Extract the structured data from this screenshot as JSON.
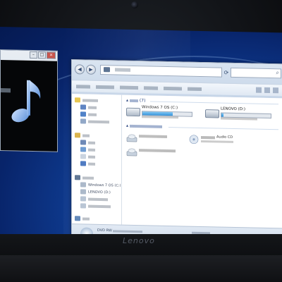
{
  "explorer": {
    "group_count": "(7)",
    "drives": [
      {
        "name": "Windows 7 OS (C:)",
        "usage_fraction": 0.62
      },
      {
        "name": "LENOVO (D:)",
        "usage_fraction": 0.04
      }
    ],
    "devices": [
      {
        "tag": "Audio CD"
      }
    ],
    "details_tag": "DVD RW"
  },
  "bezel": {
    "brand": "Lenovo"
  },
  "colors": {
    "desktop": "#0f3d93",
    "window_frame": "#c6d5e8",
    "taskbar": "#1f2f4e",
    "drive_bar": "#2c8fd9"
  }
}
